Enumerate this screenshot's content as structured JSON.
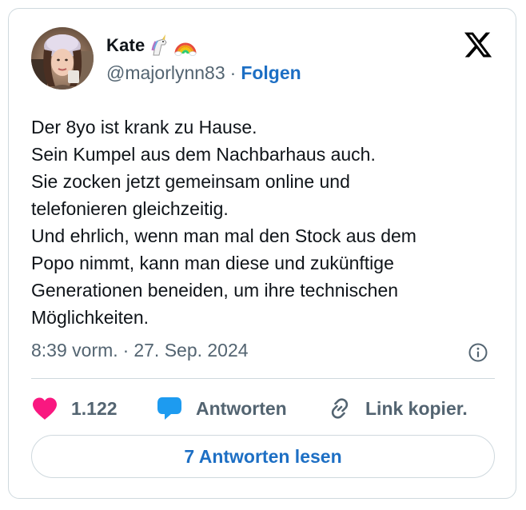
{
  "author": {
    "display_name": "Kate",
    "emojis": [
      "unicorn-emoji",
      "rainbow-emoji"
    ],
    "handle": "@majorlynn83",
    "separator": "·",
    "follow_label": "Folgen"
  },
  "platform": {
    "logo": "x-logo"
  },
  "tweet": {
    "lines": [
      "Der 8yo ist krank zu Hause.",
      "Sein Kumpel aus dem Nachbarhaus auch.",
      "Sie zocken jetzt gemeinsam online und",
      "telefonieren gleichzeitig.",
      "Und ehrlich, wenn man mal den Stock aus dem",
      "Popo nimmt, kann man diese und zukünftige",
      "Generationen beneiden, um ihre technischen",
      "Möglichkeiten."
    ],
    "time": "8:39 vorm.",
    "separator": "·",
    "date": "27. Sep. 2024"
  },
  "actions": {
    "like": {
      "icon": "heart-icon",
      "count": "1.122"
    },
    "reply": {
      "icon": "speech-bubble-icon",
      "label": "Antworten"
    },
    "copy": {
      "icon": "link-icon",
      "label": "Link kopier."
    },
    "info": {
      "icon": "info-icon"
    }
  },
  "read_replies_label": "7 Antworten lesen",
  "colors": {
    "accent": "#1d6fc4",
    "like": "#f91880",
    "reply": "#1d9bf0",
    "muted": "#536471",
    "text": "#0f1419",
    "border": "#cfd9de"
  }
}
